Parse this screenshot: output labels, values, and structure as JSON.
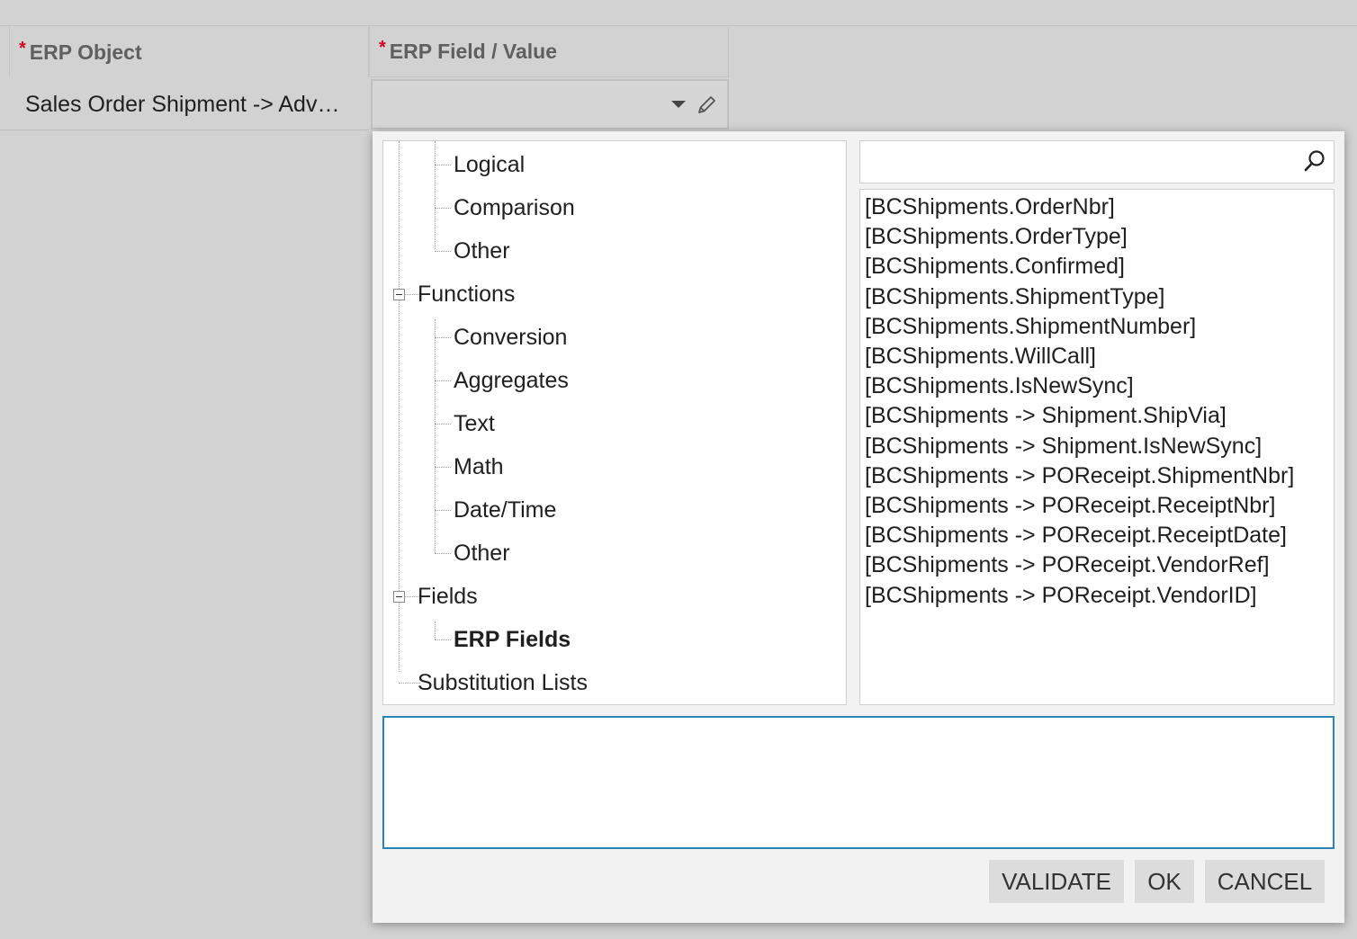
{
  "grid": {
    "headers": [
      {
        "required": "*",
        "label": "ERP Object"
      },
      {
        "required": "*",
        "label": "ERP Field / Value"
      }
    ],
    "row": {
      "erp_object": "Sales Order Shipment -> Adv…",
      "erp_field_value": ""
    }
  },
  "icons": {
    "dropdown": "chevron-down-icon",
    "edit": "pencil-icon",
    "search": "search-icon",
    "collapse": "minus-box-icon"
  },
  "tree": {
    "items": [
      {
        "label": "Logical"
      },
      {
        "label": "Comparison"
      },
      {
        "label": "Other"
      },
      {
        "label": "Functions"
      },
      {
        "label": "Conversion"
      },
      {
        "label": "Aggregates"
      },
      {
        "label": "Text"
      },
      {
        "label": "Math"
      },
      {
        "label": "Date/Time"
      },
      {
        "label": "Other"
      },
      {
        "label": "Fields"
      },
      {
        "label": "ERP Fields"
      },
      {
        "label": "Substitution Lists"
      }
    ]
  },
  "search": {
    "value": "",
    "placeholder": ""
  },
  "fields_list": [
    "[BCShipments.OrderNbr]",
    "[BCShipments.OrderType]",
    "[BCShipments.Confirmed]",
    "[BCShipments.ShipmentType]",
    "[BCShipments.ShipmentNumber]",
    "[BCShipments.WillCall]",
    "[BCShipments.IsNewSync]",
    "[BCShipments -> Shipment.ShipVia]",
    "[BCShipments -> Shipment.IsNewSync]",
    "[BCShipments -> POReceipt.ShipmentNbr]",
    "[BCShipments -> POReceipt.ReceiptNbr]",
    "[BCShipments -> POReceipt.ReceiptDate]",
    "[BCShipments -> POReceipt.VendorRef]",
    "[BCShipments -> POReceipt.VendorID]"
  ],
  "expression": {
    "value": ""
  },
  "buttons": {
    "validate": "VALIDATE",
    "ok": "OK",
    "cancel": "CANCEL"
  },
  "colors": {
    "required": "#d0021b",
    "focus_border": "#2b83b7"
  }
}
